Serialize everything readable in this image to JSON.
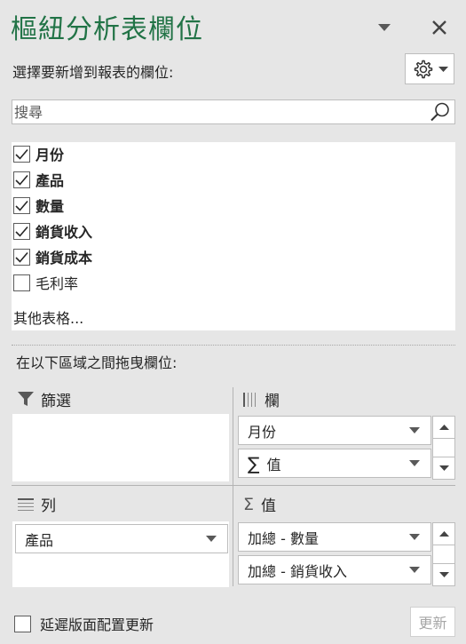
{
  "pane": {
    "title": "樞紐分析表欄位",
    "prompt": "選擇要新增到報表的欄位:",
    "search_placeholder": "搜尋",
    "more_tables": "其他表格...",
    "drag_prompt": "在以下區域之間拖曳欄位:"
  },
  "fields": [
    {
      "label": "月份",
      "checked": true
    },
    {
      "label": "產品",
      "checked": true
    },
    {
      "label": "數量",
      "checked": true
    },
    {
      "label": "銷貨收入",
      "checked": true
    },
    {
      "label": "銷貨成本",
      "checked": true
    },
    {
      "label": "毛利率",
      "checked": false
    }
  ],
  "areas": {
    "filters": {
      "label": "篩選",
      "icon": "filter-icon",
      "items": []
    },
    "columns": {
      "label": "欄",
      "icon": "columns-icon",
      "items": [
        {
          "label": "月份"
        },
        {
          "label": "值",
          "sigma": "∑"
        }
      ]
    },
    "rows": {
      "label": "列",
      "icon": "rows-icon",
      "items": [
        {
          "label": "產品"
        }
      ]
    },
    "values": {
      "label": "值",
      "icon": "sigma-icon",
      "items": [
        {
          "label": "加總 - 數量"
        },
        {
          "label": "加總 - 銷貨收入"
        }
      ]
    }
  },
  "footer": {
    "defer_label": "延遲版面配置更新",
    "defer_checked": false,
    "update_label": "更新"
  },
  "colors": {
    "title": "#217346",
    "pane_bg": "#e6e6e6",
    "disabled_text": "#a6a6a6"
  }
}
